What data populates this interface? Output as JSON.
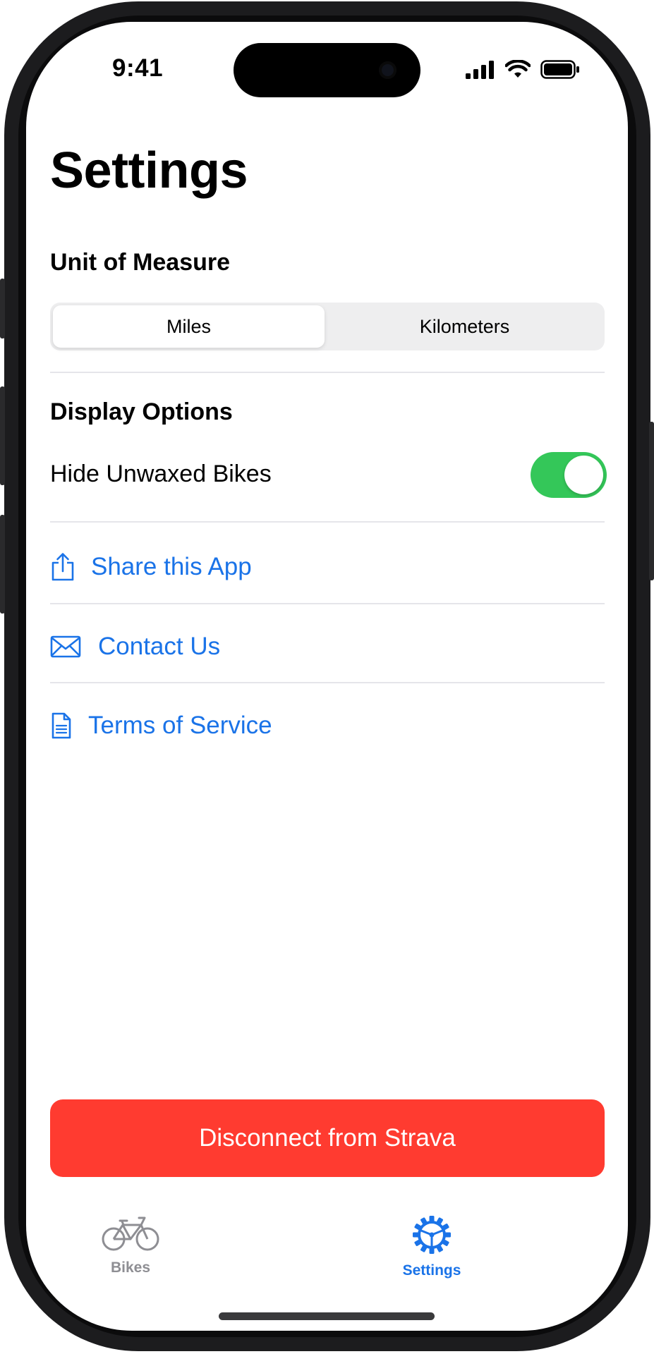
{
  "status_bar": {
    "time": "9:41"
  },
  "page": {
    "title": "Settings"
  },
  "unit_section": {
    "heading": "Unit of Measure",
    "options": [
      "Miles",
      "Kilometers"
    ],
    "selected": "Miles"
  },
  "display_section": {
    "heading": "Display Options",
    "hide_unwaxed_label": "Hide Unwaxed Bikes",
    "hide_unwaxed_on": true
  },
  "links": {
    "share": "Share this App",
    "contact": "Contact Us",
    "terms": "Terms of Service"
  },
  "disconnect_button": "Disconnect from Strava",
  "tab_bar": {
    "tabs": [
      {
        "label": "Bikes",
        "icon": "bicycle-icon",
        "active": false
      },
      {
        "label": "Settings",
        "icon": "gear-icon",
        "active": true
      }
    ]
  },
  "colors": {
    "accent": "#1a73e8",
    "toggle_on": "#34c759",
    "destructive": "#ff3b30",
    "inactive_tab": "#8e8e93"
  }
}
